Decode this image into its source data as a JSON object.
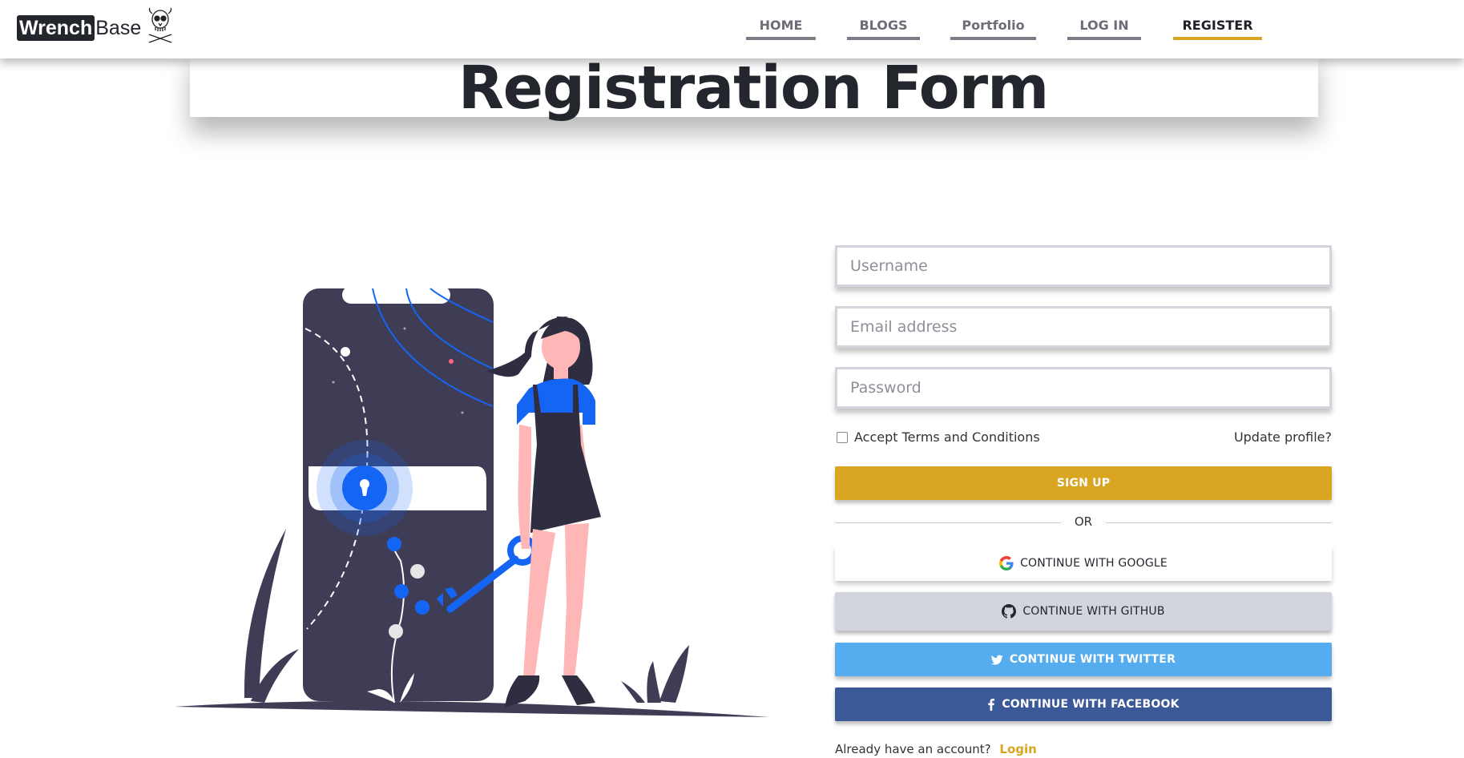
{
  "brand": {
    "dark_part": "Wrench",
    "light_part": "Base",
    "logo_icon": "skull-logo-icon"
  },
  "nav": {
    "items": [
      {
        "label": "HOME"
      },
      {
        "label": "BLOGS"
      },
      {
        "label": "Portfolio"
      },
      {
        "label": "LOG IN"
      },
      {
        "label": "REGISTER"
      }
    ],
    "active": "REGISTER"
  },
  "page": {
    "title": "Registration Form"
  },
  "form": {
    "username": {
      "placeholder": "Username",
      "value": ""
    },
    "email": {
      "placeholder": "Email address",
      "value": ""
    },
    "password": {
      "placeholder": "Password",
      "value": ""
    },
    "terms_label": "Accept Terms and Conditions",
    "terms_checked": false,
    "update_profile": "Update profile?",
    "signup": "SIGN UP",
    "or": "OR",
    "google": "CONTINUE WITH GOOGLE",
    "github": "CONTINUE WITH GITHUB",
    "twitter": "CONTINUE WITH TWITTER",
    "facebook": "CONTINUE WITH FACEBOOK",
    "already": "Already have an account?",
    "login": "Login"
  },
  "colors": {
    "accent": "#daa520",
    "dark": "#24262e",
    "twitter": "#55acee",
    "facebook": "#3b5998",
    "github_bg": "#d2d5dc",
    "illustration_blue": "#1565f5",
    "illustration_dark": "#3f3d56",
    "skin": "#ffb6b6"
  }
}
